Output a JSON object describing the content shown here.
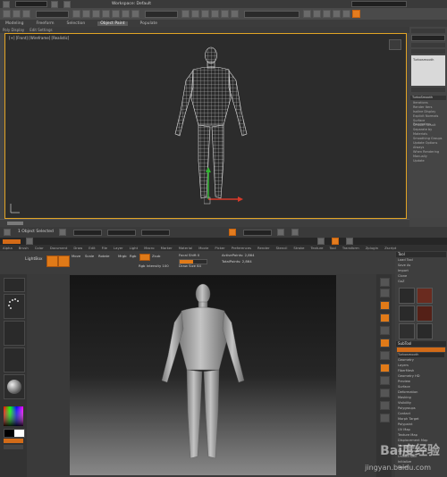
{
  "max": {
    "title": "Workspace: Default",
    "ribbon_tabs": [
      "Modeling",
      "Freeform",
      "Selection",
      "Object Paint",
      "Populate"
    ],
    "ribbon_active": "Object Paint",
    "sub_items": [
      "Poly Display",
      "Edit Settings"
    ],
    "viewport_label": "[+] [Front] [Wireframe] [Realistic]",
    "right_panel": {
      "list_label": "Turbosmooth",
      "section_main": "TurboSmooth",
      "iterations": "Iterations",
      "render_iters": "Render Iters",
      "isoline": "Isoline Display",
      "explicit": "Explicit Normals",
      "surface": "Surface Parameters",
      "smooth_result": "Smooth Result",
      "separate": "Separate by",
      "materials": "Materials",
      "sm_groups": "Smoothing Groups",
      "update": "Update Options",
      "always": "Always",
      "when_rendering": "When Rendering",
      "manually": "Manually",
      "update_btn": "Update"
    },
    "status_text": "1 Object Selected"
  },
  "zbrush": {
    "menu": [
      "Alpha",
      "Brush",
      "Color",
      "Document",
      "Draw",
      "Edit",
      "File",
      "Layer",
      "Light",
      "Macro",
      "Marker",
      "Material",
      "Movie",
      "Picker",
      "Preferences",
      "Render",
      "Stencil",
      "Stroke",
      "Texture",
      "Tool",
      "Transform",
      "Zplugin",
      "Zscript"
    ],
    "shelf": {
      "lightbox": "LightBox",
      "edit": "Edit",
      "draw": "Draw",
      "move": "Move",
      "scale": "Scale",
      "rotate": "Rotate",
      "mrgb": "Mrgb",
      "rgb": "Rgb",
      "m": "M",
      "zadd": "Zadd",
      "zsub": "Zsub",
      "focal": "Focal Shift 0",
      "draw_size": "Draw Size 64",
      "rgb_intensity": "Rgb Intensity 100",
      "z_intensity": "Z Intensity 25",
      "active_points": "ActivePoints: 2,864",
      "total_points": "TotalPoints: 2,864"
    },
    "left": {
      "brush": "Standard",
      "material": "MatCap Gray",
      "switch_color": "SwitchColor",
      "gradient": "Gradient"
    },
    "tool_panel": {
      "title": "Tool",
      "load": "Load Tool",
      "save": "Save As",
      "copy": "Copy Tool",
      "paste": "Paste Tool",
      "import": "Import",
      "export": "Export",
      "clone": "Clone",
      "make_polymesh": "Make PolyMesh3D",
      "goz": "GoZ",
      "all": "All",
      "visible": "Visible",
      "lightbox_tools": "Lightbox > Tools",
      "mesh_name": "Turbosmooth",
      "subtool": "SubTool",
      "geometry": "Geometry",
      "layers": "Layers",
      "fibermesh": "FiberMesh",
      "geometry_hd": "Geometry HD",
      "preview": "Preview",
      "surface": "Surface",
      "deformation": "Deformation",
      "masking": "Masking",
      "visibility": "Visibility",
      "polygroups": "Polygroups",
      "contact": "Contact",
      "morph_target": "Morph Target",
      "polypaint": "Polypaint",
      "uv_map": "UV Map",
      "texture_map": "Texture Map",
      "displacement": "Displacement Map",
      "normal_map": "Normal Map",
      "vector_map": "Vector Displacement Map",
      "display_props": "Display Properties",
      "unified_skin": "Unified Skin",
      "initialize": "Initialize",
      "import2": "Import",
      "export2": "Export"
    }
  },
  "watermark": {
    "logo": "Bai度经验",
    "url": "jingyan.baidu.com"
  },
  "colors": {
    "accent": "#e07a18",
    "max_bg": "#444444",
    "viewport_border": "#e2a425"
  }
}
